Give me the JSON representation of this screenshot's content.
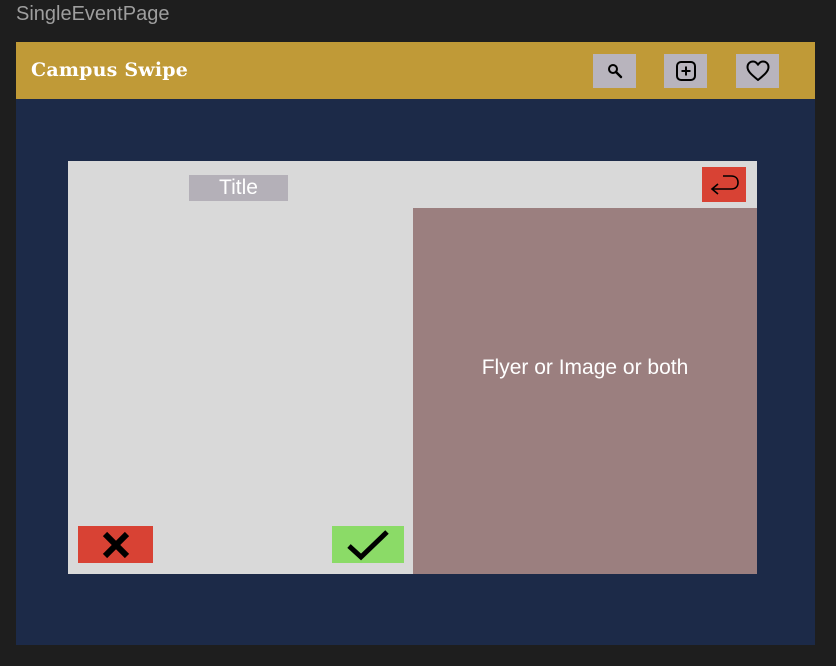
{
  "frame": {
    "label": "SingleEventPage"
  },
  "header": {
    "brand": "Campus Swipe",
    "buttons": [
      {
        "icon": "search-icon"
      },
      {
        "icon": "add-icon"
      },
      {
        "icon": "heart-icon"
      }
    ],
    "colors": {
      "bar": "#c09a37",
      "button": "#b8b4bd"
    }
  },
  "card": {
    "title": "Title",
    "media_text": "Flyer or Image or both",
    "back_icon": "return-arrow-icon",
    "reject_icon": "x-icon",
    "accept_icon": "checkmark-icon",
    "colors": {
      "background": "#1c2a48",
      "card": "#d9d9d9",
      "media": "#9b7f7f",
      "reject": "#d84234",
      "accept": "#8bdb67"
    }
  }
}
